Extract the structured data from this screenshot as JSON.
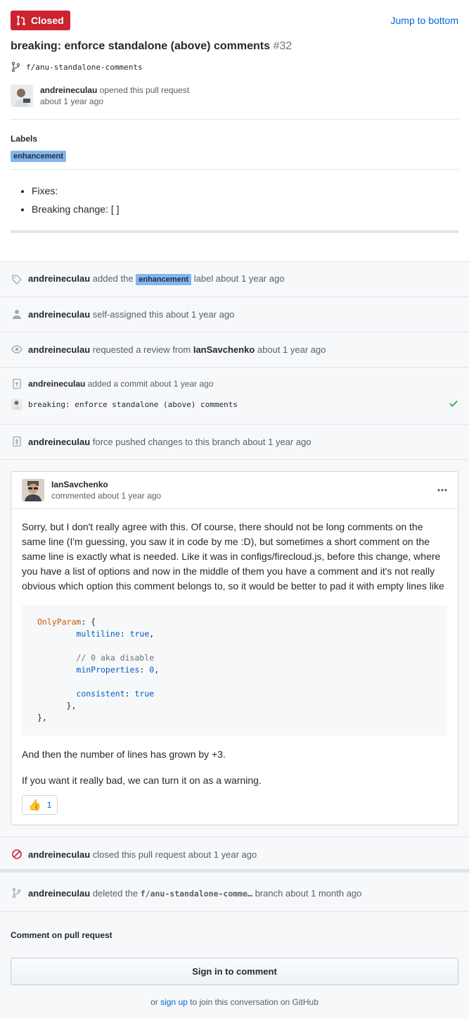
{
  "header": {
    "state": "Closed",
    "jump_label": "Jump to bottom",
    "title": "breaking: enforce standalone (above) comments",
    "number": "#32",
    "branch": "f/anu-standalone-comments",
    "author": "andreineculau",
    "opened_text": "opened this pull request",
    "opened_time": "about 1 year ago"
  },
  "labels": {
    "heading": "Labels",
    "items": [
      "enhancement"
    ]
  },
  "body_items": [
    "Fixes:",
    "Breaking change: [ ]"
  ],
  "timeline": {
    "label_event": {
      "who": "andreineculau",
      "pre": "added the",
      "label": "enhancement",
      "post": "label about 1 year ago"
    },
    "assign_event": {
      "who": "andreineculau",
      "text": "self-assigned this about 1 year ago"
    },
    "review_event": {
      "who": "andreineculau",
      "pre": "requested a review from",
      "reviewer": "IanSavchenko",
      "post": "about 1 year ago"
    },
    "commit_event": {
      "who": "andreineculau",
      "text": "added a commit about 1 year ago",
      "commit_msg": "breaking: enforce standalone (above) comments"
    },
    "push_event": {
      "who": "andreineculau",
      "text": "force pushed changes to this branch about 1 year ago"
    },
    "close_event": {
      "who": "andreineculau",
      "text": "closed this pull request about 1 year ago"
    },
    "delete_event": {
      "who": "andreineculau",
      "pre": "deleted the",
      "branch": "f/anu-standalone-comme…",
      "post": "branch about 1 month ago"
    }
  },
  "comment": {
    "author": "IanSavchenko",
    "meta": "commented about 1 year ago",
    "para1": "Sorry, but I don't really agree with this. Of course, there should not be long comments on the same line (I'm guessing, you saw it in code by me :D), but sometimes a short comment on the same line is exactly what is needed. Like it was in configs/firecloud.js, before this change, where you have a list of options and now in the middle of them you have a comment and it's not really obvious which option this comment belongs to, so it would be better to pad it with empty lines like",
    "code": {
      "line1_key": "OnlyParam",
      "line1_rest": ": {",
      "multiline_key": "multiline",
      "multiline_val": "true",
      "comment_text": "// 0 aka disable",
      "minprops_key": "minProperties",
      "minprops_val": "0",
      "consistent_key": "consistent",
      "consistent_val": "true"
    },
    "para2": "And then the number of lines has grown by +3.",
    "para3": "If you want it really bad, we can turn it on as a warning.",
    "reaction_count": "1"
  },
  "footer": {
    "heading": "Comment on pull request",
    "signin_label": "Sign in to comment",
    "or_text": "or",
    "signup_label": "sign up",
    "tail_text": "to join this conversation on GitHub"
  },
  "colors": {
    "closed": "#cb2431",
    "link": "#0366d6",
    "label": "#84b6eb",
    "success": "#28a745"
  }
}
